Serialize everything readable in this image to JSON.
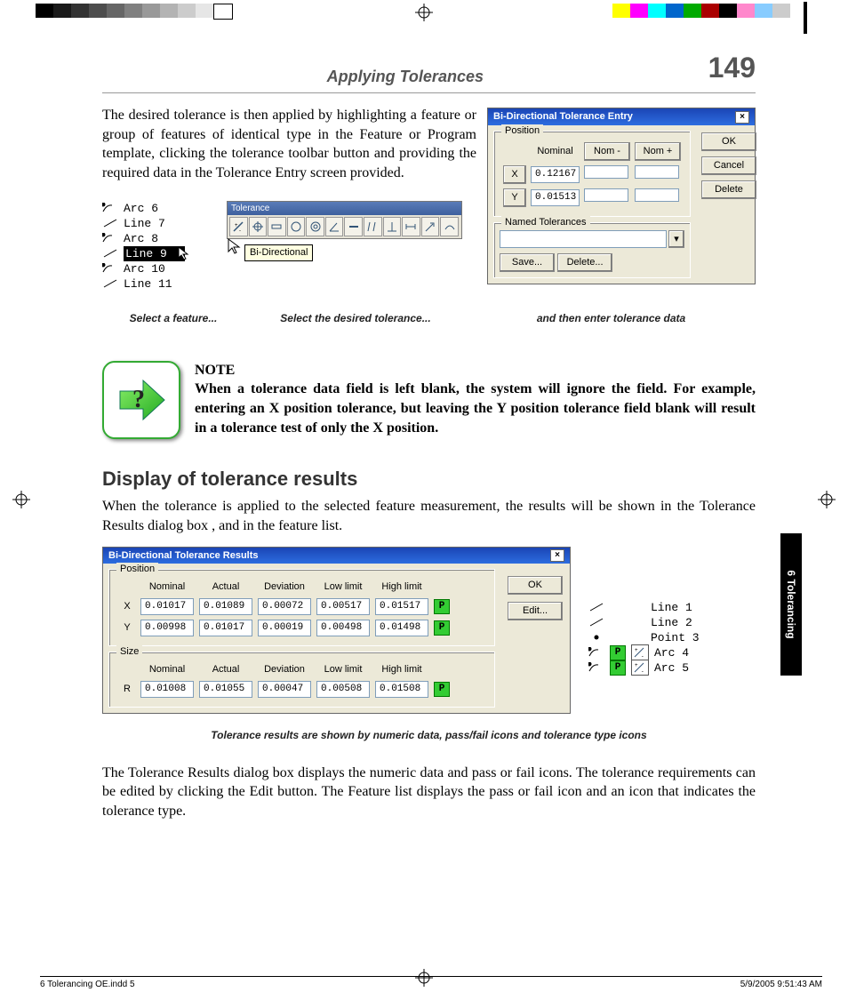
{
  "header": {
    "title": "Applying Tolerances",
    "page_number": "149"
  },
  "para1": "The desired tolerance is then applied by highlighting a feature or group of features of identical type in the Feature or Program template, clicking the tolerance toolbar button and providing the required data in the Tolerance Entry screen provided.",
  "entry_dlg": {
    "title": "Bi-Directional Tolerance Entry",
    "pos_legend": "Position",
    "cols": {
      "nominal": "Nominal",
      "nom_minus": "Nom -",
      "nom_plus": "Nom +"
    },
    "rows": {
      "X": {
        "lab": "X",
        "nominal": "0.12167"
      },
      "Y": {
        "lab": "Y",
        "nominal": "0.01513"
      }
    },
    "named_legend": "Named Tolerances",
    "buttons": {
      "ok": "OK",
      "cancel": "Cancel",
      "delete": "Delete",
      "save": "Save...",
      "delete2": "Delete..."
    }
  },
  "feature_list": [
    "Arc 6",
    "Line 7",
    "Arc 8",
    "Line 9",
    "Arc 10",
    "Line 11"
  ],
  "toolbar": {
    "title": "Tolerance",
    "tooltip": "Bi-Directional"
  },
  "captions": {
    "c1": "Select a feature...",
    "c2": "Select the desired tolerance...",
    "c3": "and then enter tolerance data",
    "results": "Tolerance results are shown by numeric data, pass/fail icons and tolerance type icons"
  },
  "note": {
    "heading": "NOTE",
    "body": "When a tolerance data field is left blank, the system will ignore the field.  For example, entering an X position tolerance, but leaving the Y position tolerance field blank will result in a tolerance test of only the X position."
  },
  "h2": "Display of tolerance results",
  "para2": "When the tolerance is applied to the selected feature measurement, the results will be shown in the Tolerance Results dialog box , and in the feature list.",
  "results_dlg": {
    "title": "Bi-Directional Tolerance Results",
    "pos_legend": "Position",
    "size_legend": "Size",
    "cols": {
      "nominal": "Nominal",
      "actual": "Actual",
      "deviation": "Deviation",
      "low": "Low limit",
      "high": "High limit"
    },
    "pos": {
      "X": {
        "lab": "X",
        "nominal": "0.01017",
        "actual": "0.01089",
        "deviation": "0.00072",
        "low": "0.00517",
        "high": "0.01517",
        "pf": "P"
      },
      "Y": {
        "lab": "Y",
        "nominal": "0.00998",
        "actual": "0.01017",
        "deviation": "0.00019",
        "low": "0.00498",
        "high": "0.01498",
        "pf": "P"
      }
    },
    "size": {
      "R": {
        "lab": "R",
        "nominal": "0.01008",
        "actual": "0.01055",
        "deviation": "0.00047",
        "low": "0.00508",
        "high": "0.01508",
        "pf": "P"
      }
    },
    "buttons": {
      "ok": "OK",
      "edit": "Edit..."
    }
  },
  "result_features": [
    "Line 1",
    "Line 2",
    "Point 3",
    "Arc 4",
    "Arc 5"
  ],
  "para3": "The Tolerance Results dialog box displays the numeric data and pass or fail icons.  The tolerance requirements can be edited by clicking the Edit button.  The Feature list displays the pass or fail icon and an icon that indicates the tolerance type.",
  "side_tab": "6  Tolerancing",
  "footer": {
    "left": "6 Tolerancing OE.indd   5",
    "right": "5/9/2005   9:51:43 AM"
  },
  "swatch_left": [
    "#000",
    "#1a1a1a",
    "#333",
    "#4d4d4d",
    "#666",
    "#808080",
    "#999",
    "#b3b3b3",
    "#ccc",
    "#e6e6e6",
    "#fff"
  ],
  "swatch_right": [
    "#ff0",
    "#f0f",
    "#0ff",
    "#06c",
    "#0a0",
    "#a00",
    "#000",
    "#f8c",
    "#8cf",
    "#ccc"
  ]
}
